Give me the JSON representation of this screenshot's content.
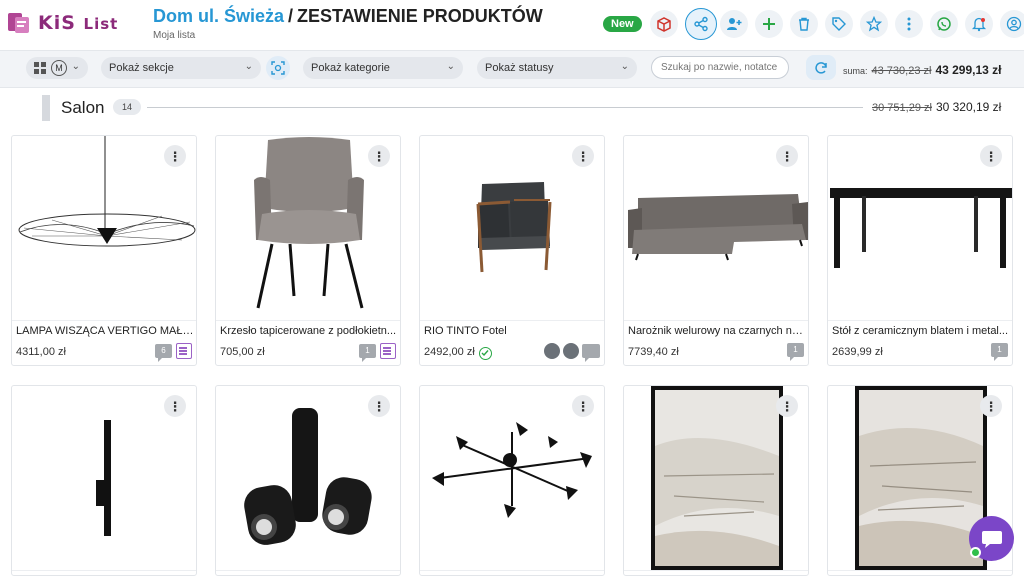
{
  "brand": {
    "name": "KiS",
    "name_sub": "List"
  },
  "header": {
    "project": "Dom ul. Świeża",
    "separator": "/",
    "sheet": "ZESTAWIENIE PRODUKTÓW",
    "subtitle": "Moja lista",
    "new_badge": "New",
    "icons": [
      "box-icon",
      "share-icon",
      "add-user-icon",
      "plus-icon",
      "trash-icon",
      "tag-icon",
      "star-icon",
      "more-icon",
      "whatsapp-icon",
      "bell-icon",
      "user-icon"
    ]
  },
  "filters": {
    "view_label": "M",
    "sections": "Pokaż sekcje",
    "categories": "Pokaż kategorie",
    "statuses": "Pokaż statusy",
    "search_placeholder": "Szukaj po nazwie, notatce",
    "sum_label": "suma:",
    "sum_old": "43 730,23 zł",
    "sum_new": "43 299,13 zł"
  },
  "section": {
    "title": "Salon",
    "count": "14",
    "sum_old": "30 751,29 zł",
    "sum_new": "30 320,19 zł"
  },
  "products": [
    {
      "name": "LAMPA WISZĄCA VERTIGO MAŁA ...",
      "price": "4311,00 zł",
      "comments": "6",
      "note": true
    },
    {
      "name": "Krzesło tapicerowane z podłokietn...",
      "price": "705,00 zł",
      "comments": "1",
      "note": true
    },
    {
      "name": "RIO TINTO Fotel",
      "price": "2492,00 zł",
      "status_ok": true
    },
    {
      "name": "Narożnik welurowy na czarnych nó...",
      "price": "7739,40 zł",
      "comments": "1"
    },
    {
      "name": "Stół z ceramicznym blatem i metal...",
      "price": "2639,99 zł",
      "comments": "1"
    }
  ],
  "colors": {
    "brand": "#8c2a7a",
    "accent": "#2797d4",
    "new": "#29a745",
    "chat": "#7b46c8"
  }
}
